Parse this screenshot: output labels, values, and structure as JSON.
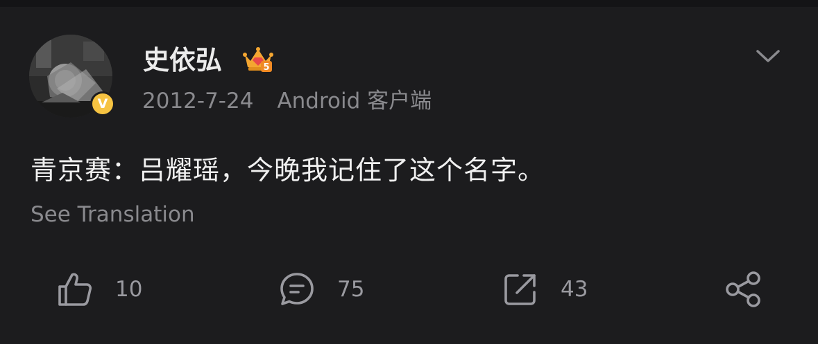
{
  "post": {
    "author": {
      "name": "史依弘",
      "verified_badge": "V",
      "membership_icon": "crown-level-5-icon",
      "badge_color": "#f6c342"
    },
    "timestamp": "2012-7-24",
    "source": "Android 客户端",
    "text": "青京赛：吕耀瑶，今晚我记住了这个名字。",
    "translate_label": "See Translation"
  },
  "actions": {
    "like_count": "10",
    "comment_count": "75",
    "repost_count": "43"
  },
  "colors": {
    "background": "#1c1c1e",
    "secondary_text": "#8a8a8e",
    "icon": "#9a9aa0"
  }
}
